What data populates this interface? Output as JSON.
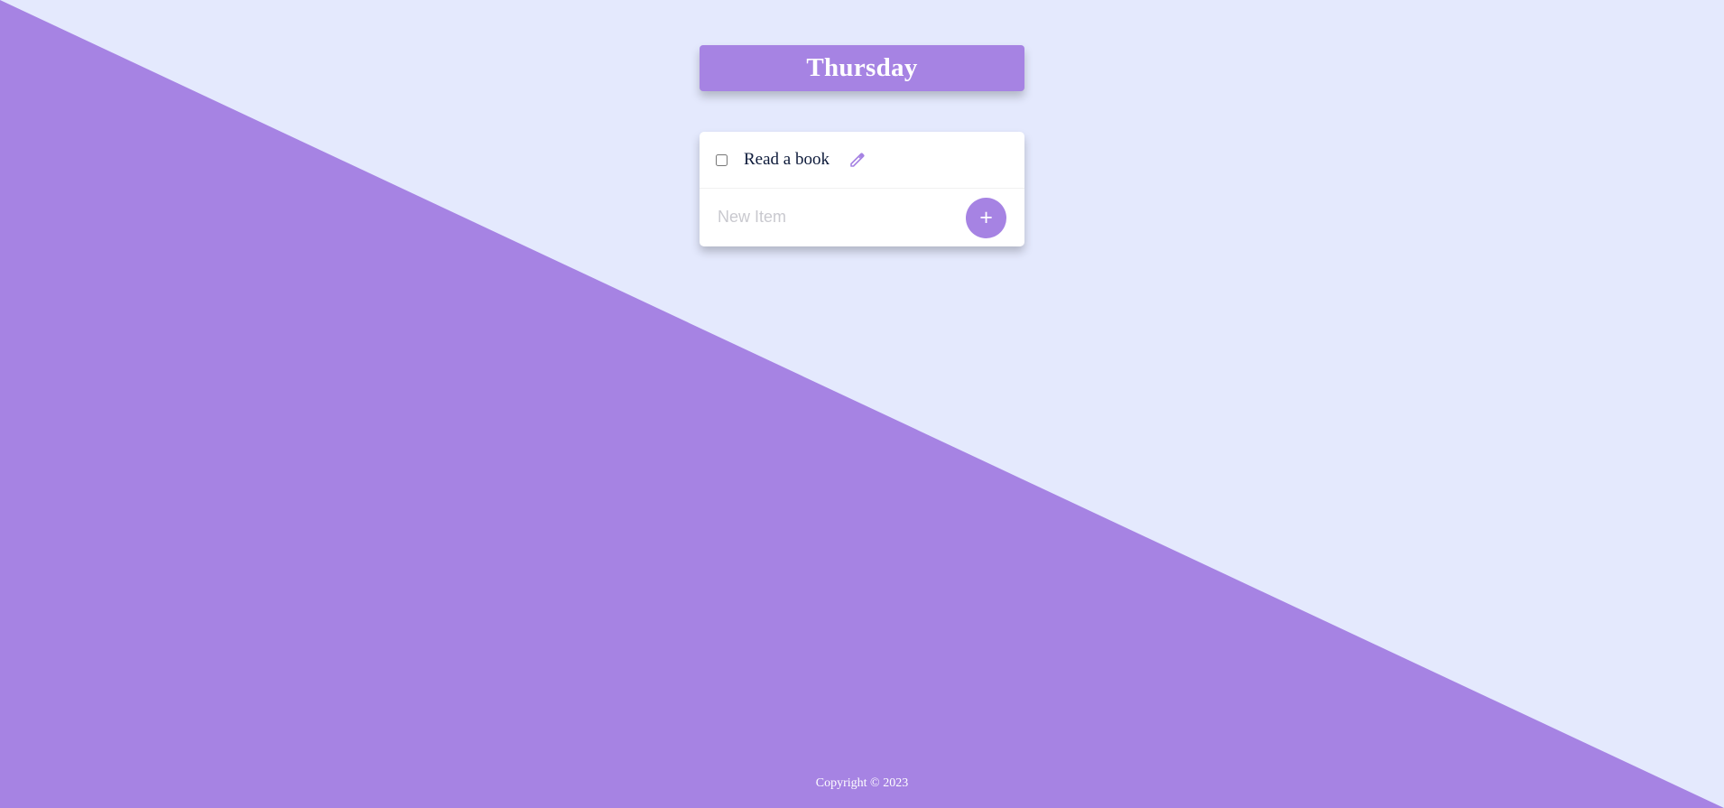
{
  "theme": {
    "background": "#E4E9FD",
    "accent": "#A683E3",
    "text_dark": "#0D1A3A"
  },
  "header": {
    "title": "Thursday"
  },
  "list": {
    "items": [
      {
        "label": "Read a book",
        "checked": false,
        "action_icon": "pencil-icon"
      }
    ],
    "new_item": {
      "placeholder": "New Item",
      "value": "",
      "add_label": "+"
    }
  },
  "footer": {
    "text": "Copyright © 2023"
  }
}
